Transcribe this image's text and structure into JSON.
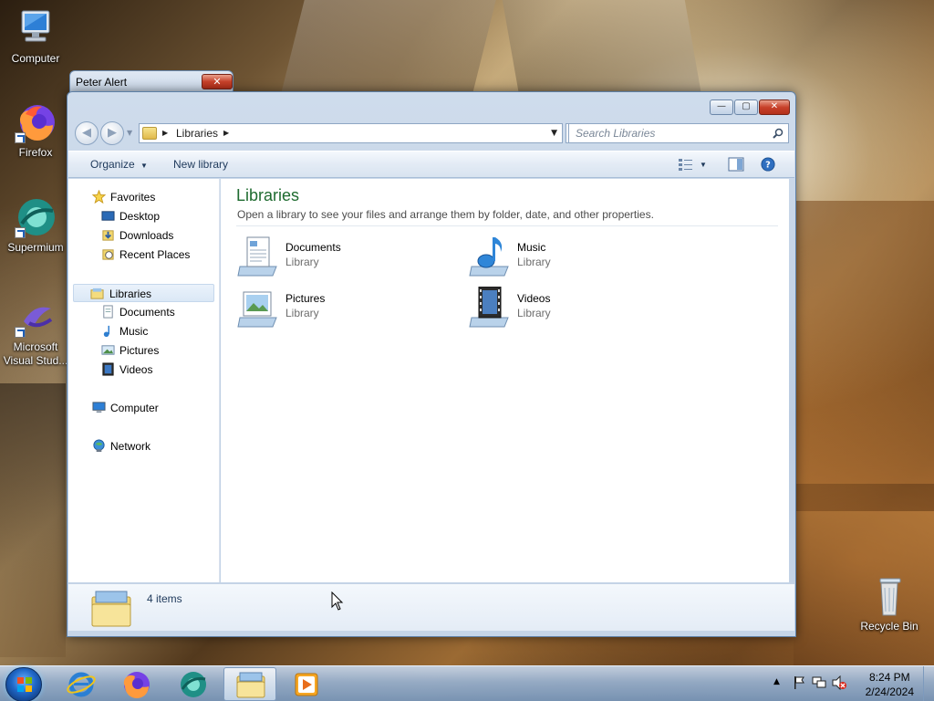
{
  "desktop": {
    "icons": [
      {
        "label": "Computer",
        "icon": "computer-icon"
      },
      {
        "label": "Firefox",
        "icon": "firefox-icon"
      },
      {
        "label": "Supermium",
        "icon": "supermium-icon"
      },
      {
        "label": "Microsoft Visual Stud...",
        "icon": "visual-studio-icon"
      },
      {
        "label": "Recycle Bin",
        "icon": "recycle-bin-icon"
      }
    ]
  },
  "alert_window": {
    "title": "Peter Alert",
    "close_glyph": "✕"
  },
  "explorer": {
    "caption_buttons": {
      "minimize": "—",
      "maximize": "▢",
      "close": "✕"
    },
    "nav": {
      "back": "◀",
      "forward": "▶"
    },
    "address": {
      "crumb": "Libraries"
    },
    "search": {
      "placeholder": "Search Libraries"
    },
    "toolbar": {
      "organize": "Organize",
      "new_library": "New library"
    },
    "nav_pane": {
      "favorites": "Favorites",
      "favorites_items": [
        "Desktop",
        "Downloads",
        "Recent Places"
      ],
      "libraries": "Libraries",
      "libraries_items": [
        "Documents",
        "Music",
        "Pictures",
        "Videos"
      ],
      "computer": "Computer",
      "network": "Network"
    },
    "content": {
      "title": "Libraries",
      "description": "Open a library to see your files and arrange them by folder, date, and other properties.",
      "items": [
        {
          "name": "Documents",
          "type": "Library"
        },
        {
          "name": "Music",
          "type": "Library"
        },
        {
          "name": "Pictures",
          "type": "Library"
        },
        {
          "name": "Videos",
          "type": "Library"
        }
      ]
    },
    "status": {
      "count": "4 items"
    }
  },
  "taskbar": {
    "pinned": [
      "internet-explorer-icon",
      "firefox-icon",
      "supermium-icon",
      "libraries-folder-icon",
      "media-player-icon"
    ],
    "clock": {
      "time": "8:24 PM",
      "date": "2/24/2024"
    }
  },
  "colors": {
    "accent_title": "#1e6b2f",
    "selection": "#dbe8f6",
    "close_red": "#c8412a"
  }
}
